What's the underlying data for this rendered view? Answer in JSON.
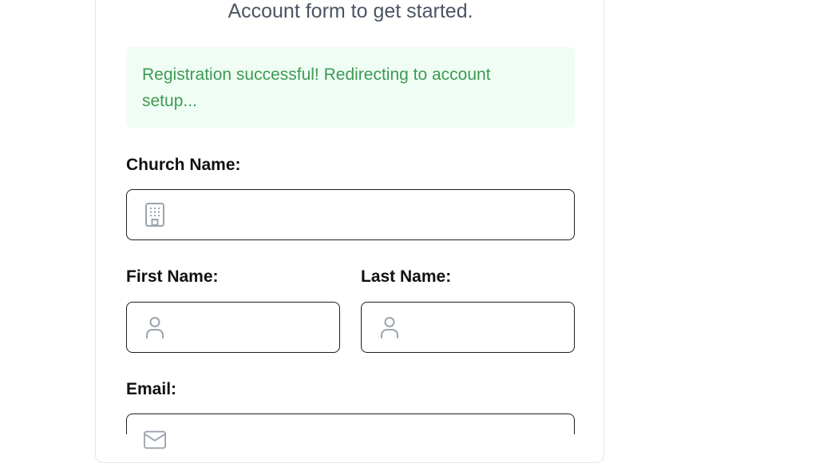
{
  "header": {
    "subtitle": "Account form to get started."
  },
  "alert": {
    "message": "Registration successful! Redirecting to account setup...",
    "color": "#3d9a52",
    "background": "#f0fdf4"
  },
  "form": {
    "church_name": {
      "label": "Church Name:",
      "value": "",
      "placeholder": "",
      "icon": "building-icon"
    },
    "first_name": {
      "label": "First Name:",
      "value": "",
      "placeholder": "",
      "icon": "user-icon"
    },
    "last_name": {
      "label": "Last Name:",
      "value": "",
      "placeholder": "",
      "icon": "user-icon"
    },
    "email": {
      "label": "Email:",
      "value": "",
      "placeholder": "",
      "icon": "mail-icon"
    }
  }
}
